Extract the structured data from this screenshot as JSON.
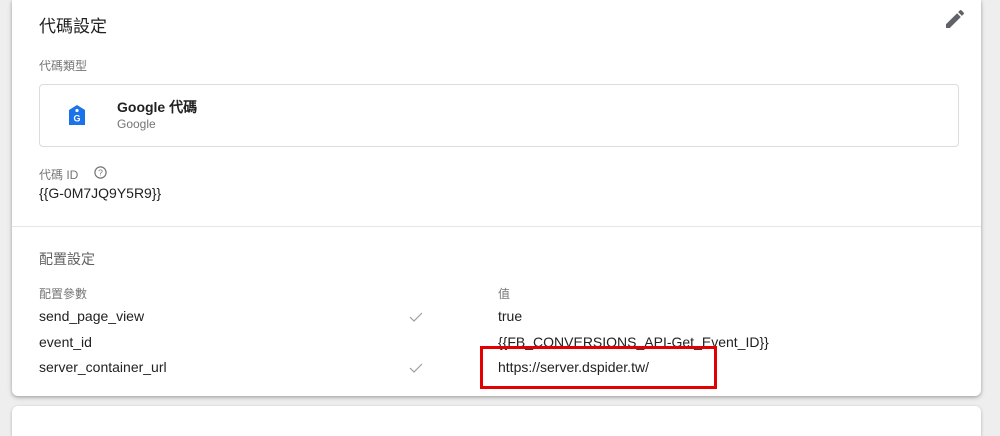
{
  "card": {
    "title": "代碼設定",
    "tag_type_label": "代碼類型",
    "tag_type": {
      "name": "Google 代碼",
      "vendor": "Google"
    },
    "tag_id_label": "代碼 ID",
    "tag_id_value": "{{G-0M7JQ9Y5R9}}"
  },
  "config": {
    "section_title": "配置設定",
    "param_header": "配置參數",
    "value_header": "值",
    "rows": [
      {
        "name": "send_page_view",
        "checked": true,
        "value": "true"
      },
      {
        "name": "event_id",
        "checked": false,
        "value": "{{FB_CONVERSIONS_API-Get_Event_ID}}"
      },
      {
        "name": "server_container_url",
        "checked": true,
        "value": "https://server.dspider.tw/"
      }
    ]
  },
  "colors": {
    "highlight_border": "#e30000",
    "tag_icon": "#1a73e8",
    "check": "#9e9e9e"
  },
  "icons": {
    "edit": "pencil-icon",
    "tag_type": "google-tag-icon",
    "help": "help-circle-icon",
    "check": "checkmark-icon"
  }
}
